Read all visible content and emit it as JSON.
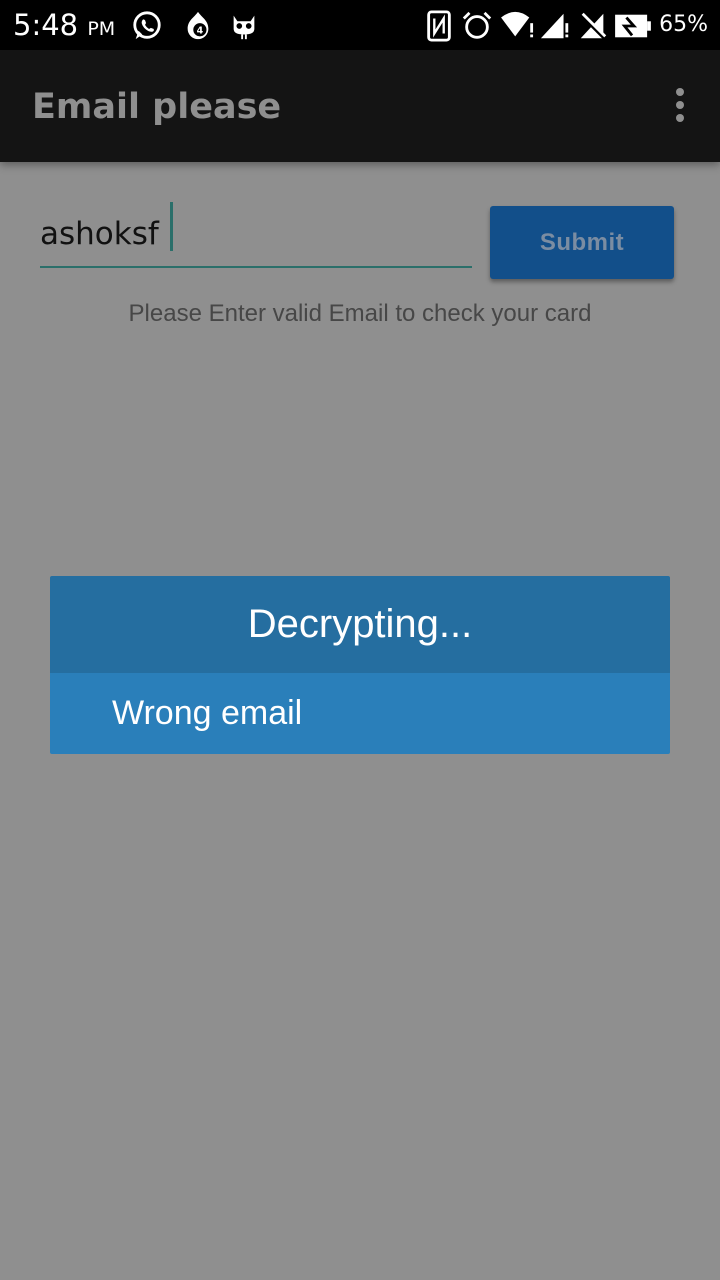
{
  "status_bar": {
    "time": "5:48",
    "ampm": "PM",
    "battery": "65%",
    "notification_badge": "4",
    "icons": [
      "whatsapp-icon",
      "notification-badge-icon",
      "cyanogen-mascot-icon",
      "nfc-icon",
      "alarm-icon",
      "wifi-icon",
      "signal-icon",
      "no-signal-icon",
      "battery-icon"
    ]
  },
  "app_bar": {
    "title": "Email please",
    "menu_icon": "more-vertical-icon"
  },
  "form": {
    "email_value": "ashoksf",
    "submit_label": "Submit",
    "helper_text": "Please Enter valid Email to check your card"
  },
  "dialog": {
    "title": "Decrypting...",
    "message": "Wrong email"
  },
  "colors": {
    "scrim": "#8f8f8f",
    "app_bar": "#141414",
    "status_bar": "#000000",
    "dialog_header": "#256ea0",
    "dialog_body": "#2a7fba",
    "submit_button": "#124f8a",
    "input_underline": "#2b6f6a"
  }
}
